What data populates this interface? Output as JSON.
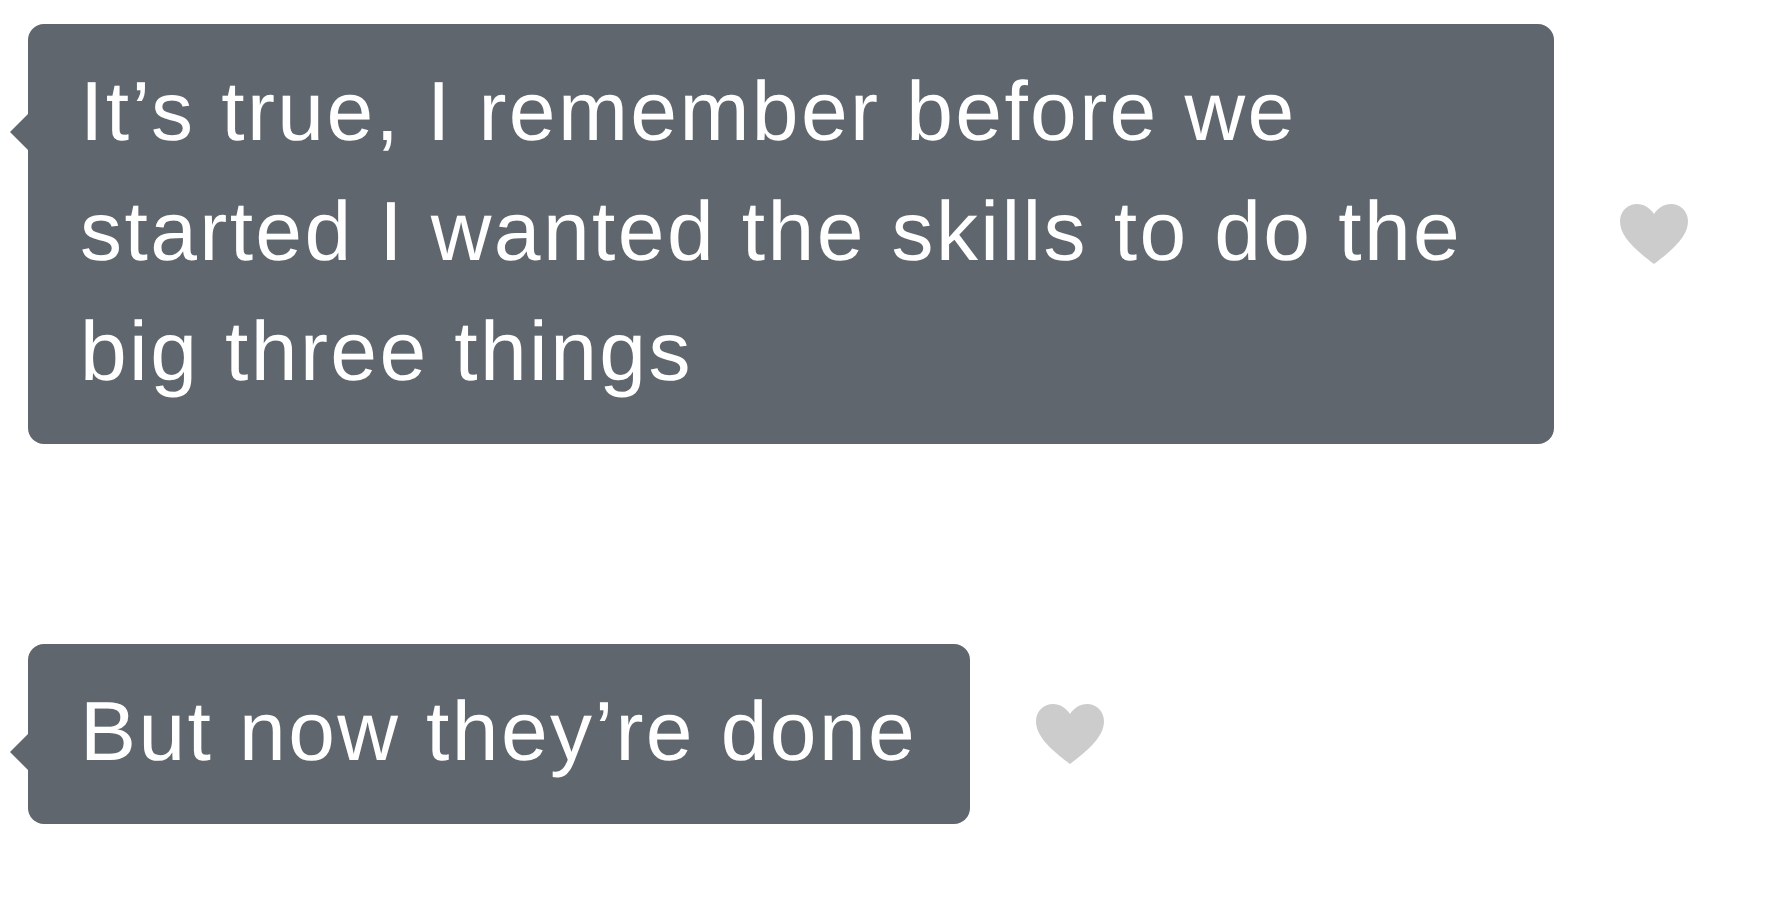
{
  "messages": [
    {
      "text": "It’s true, I remember before we started I wanted the skills to do the big three things",
      "liked": false
    },
    {
      "text": "But now they’re done",
      "liked": false
    }
  ]
}
